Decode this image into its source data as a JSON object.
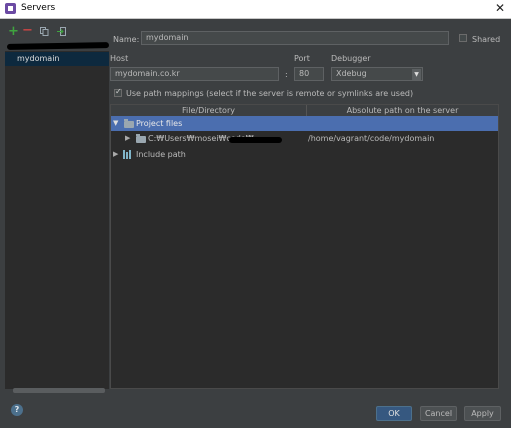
{
  "window": {
    "title": "Servers",
    "close_glyph": "✕"
  },
  "toolbar": {
    "add": "+",
    "remove": "−"
  },
  "servers": [
    {
      "name": "mydomain"
    }
  ],
  "form": {
    "name_label": "Name:",
    "name_value": "mydomain",
    "shared_label": "Shared",
    "shared_checked": false,
    "host_label": "Host",
    "host_value": "mydomain.co.kr",
    "port_label": "Port",
    "colon": ":",
    "port_value": "80",
    "debugger_label": "Debugger",
    "debugger_value": "Xdebug",
    "path_mappings_label": "Use path mappings (select if the server is remote or symlinks are used)",
    "path_mappings_checked": true
  },
  "mappings": {
    "col_file": "File/Directory",
    "col_remote": "Absolute path on the server",
    "rows": [
      {
        "label": "Project files"
      },
      {
        "label": "C:₩Users₩mosei₩code₩",
        "remote": "/home/vagrant/code/mydomain"
      },
      {
        "label": "Include path"
      }
    ]
  },
  "buttons": {
    "help": "?",
    "ok": "OK",
    "cancel": "Cancel",
    "apply": "Apply"
  }
}
